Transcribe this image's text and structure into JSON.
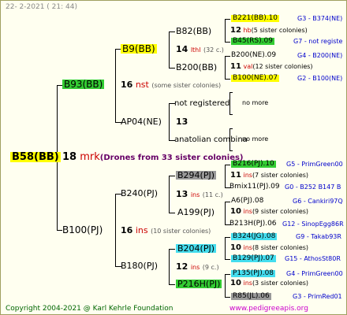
{
  "header": {
    "date": "22-  2-2021 ( 21: 44)"
  },
  "footer": {
    "copyright": "Copyright 2004-2021 @ Karl Kehrle Foundation",
    "site": "www.pedigreeapis.org"
  },
  "root": {
    "id": "B58(BB)",
    "num": "18",
    "ins": "mrk",
    "note": "(Drones from 33 sister colonies)"
  },
  "gen1": [
    {
      "id": "B93(BB)",
      "num": "16",
      "ins": "nst",
      "note": "(some sister colonies)"
    },
    {
      "id": "B100(PJ)",
      "num": "16",
      "ins": "ins",
      "note": "(10 sister colonies)"
    }
  ],
  "gen2": [
    {
      "id": "B9(BB)",
      "num": "14",
      "ins": "lthl",
      "note": "(32 c.)"
    },
    {
      "id": "AP04(NE)",
      "num": "13",
      "ins": "",
      "note": ""
    },
    {
      "id": "B240(PJ)",
      "num": "13",
      "ins": "ins",
      "note": "(11 c.)"
    },
    {
      "id": "B180(PJ)",
      "num": "12",
      "ins": "ins",
      "note": "(9 c.)"
    }
  ],
  "gen3": [
    {
      "id": "B82(BB)",
      "num": "12",
      "ins": "hb",
      "note": "(5 sister colonies)"
    },
    {
      "id": "B200(BB)",
      "num": "11",
      "ins": "val",
      "note": "(12 sister colonies)"
    },
    {
      "id": "not registered",
      "num": "",
      "ins": "",
      "note": ""
    },
    {
      "id": "anatolian combina",
      "num": "",
      "ins": "",
      "note": ""
    },
    {
      "id": "B294(PJ)",
      "num": "11",
      "ins": "ins",
      "note": "(7 sister colonies)"
    },
    {
      "id": "A199(PJ)",
      "num": "10",
      "ins": "ins",
      "note": "(9 sister colonies)"
    },
    {
      "id": "B204(PJ)",
      "num": "10",
      "ins": "ins",
      "note": "(8 sister colonies)"
    },
    {
      "id": "P216H(PJ)",
      "num": "10",
      "ins": "ins",
      "note": "(3 sister colonies)"
    }
  ],
  "gen4": [
    {
      "id": "B221(BB).10",
      "ref": "G3 - B374(NE)"
    },
    {
      "id": "B45(RS).09",
      "ref": "G7 - not registe"
    },
    {
      "id": "B200(NE).09",
      "ref": "G4 - B200(NE)"
    },
    {
      "id": "B100(NE).07",
      "ref": "G2 - B100(NE)"
    },
    {
      "id": "no more",
      "ref": ""
    },
    {
      "id": "no more",
      "ref": ""
    },
    {
      "id": "B216(PJ).10",
      "ref": "G5 - PrimGreen00"
    },
    {
      "id": "Bmix11(PJ).09",
      "ref": "G0 - B252 B147 B"
    },
    {
      "id": "A6(PJ).08",
      "ref": "G6 - Cankiri97Q"
    },
    {
      "id": "B213H(PJ).06",
      "ref": "G12 - SinopEgg86R"
    },
    {
      "id": "B324(JG).08",
      "ref": "G9 - Takab93R"
    },
    {
      "id": "B129(PJ).07",
      "ref": "G15 - AthosSt80R"
    },
    {
      "id": "P135(PJ).08",
      "ref": "G4 - PrimGreen00"
    },
    {
      "id": "R85(JL).06",
      "ref": "G3 - PrimRed01"
    }
  ],
  "colors": {
    "yellow": "#ffff00",
    "green": "#33cc33",
    "gray": "#999999",
    "cyan": "#44ddee",
    "red": "#cc0000",
    "blue": "#0000cc"
  }
}
